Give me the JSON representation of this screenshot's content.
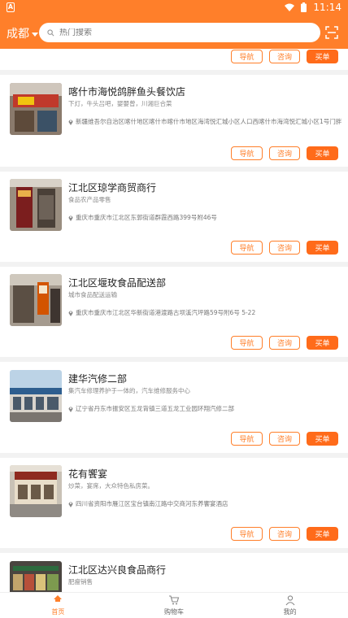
{
  "status": {
    "time": "11:14"
  },
  "header": {
    "city": "成都",
    "search_placeholder": "热门搜索"
  },
  "buttons": {
    "nav": "导航",
    "consult": "咨询",
    "buy": "买单"
  },
  "shops": [
    {
      "name": "喀什市海悦鸽胖鱼头餐饮店",
      "desc": "下灯，牛头吕吧，婴嬰曾，川湘巨合菜",
      "address": "新疆维吾尔自治区喀什地区喀什市喀什市地区海湾悦汇城小区人口西喀什市海湾悦汇城小区1号门胖鱼头餐饮堂"
    },
    {
      "name": "江北区琼学商贸商行",
      "desc": "食品农产品零售",
      "address": "重庆市重庆市江北区东郭街道群霞西路399号附46号"
    },
    {
      "name": "江北区堰玫食品配送部",
      "desc": "城市食品配送运输",
      "address": "重庆市重庆市江北区华新街道港渡路古坝溪汽坪路59号附6号 5-22"
    },
    {
      "name": "建华汽修二部",
      "desc": "集汽车修理养护于一体的，汽车维修服务中心",
      "address": "辽宁省丹东市振安区五龙背镇三道五龙工业园环翔汽修二部"
    },
    {
      "name": "花有饗宴",
      "desc": "炒菜，宴席，大众特色私房菜。",
      "address": "四川省资阳市雁江区宝台镇南江路中交商河东养饗宴酒店"
    },
    {
      "name": "江北区达兴良食品商行",
      "desc": "肥瘦销售",
      "address": ""
    }
  ],
  "tabbar": {
    "home": "首页",
    "cart": "购物车",
    "mine": "我的"
  },
  "colors": {
    "accent": "#ff7f2a",
    "buy": "#ff6b1a"
  }
}
